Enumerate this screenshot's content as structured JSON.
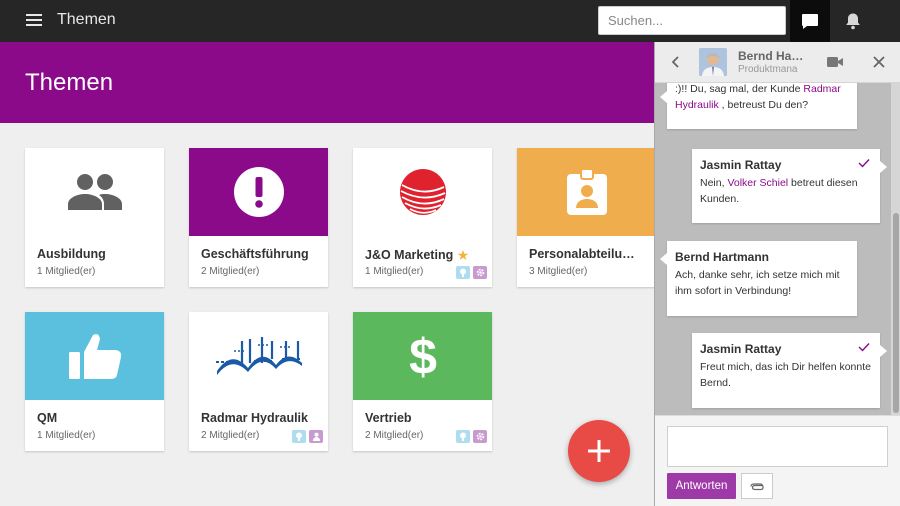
{
  "topbar": {
    "title": "Themen",
    "search_placeholder": "Suchen...",
    "menu_icon": "hamburger-icon",
    "chat_icon": "chat-bubble-icon",
    "notification_icon": "bell-icon"
  },
  "header": {
    "title": "Themen",
    "color": "#8a0a8a"
  },
  "tiles": [
    {
      "name": "Ausbildung",
      "members": "1 Mitglied(er)",
      "icon": "people-icon",
      "color": "#ffffff"
    },
    {
      "name": "Geschäftsführung",
      "members": "2 Mitglied(er)",
      "icon": "exclamation-icon",
      "color": "#8a0a8a"
    },
    {
      "name": "J&O Marketing",
      "members": "1 Mitglied(er)",
      "icon": "marketing-logo",
      "color": "#ffffff",
      "starred": true,
      "badges": [
        "lightbulb-icon",
        "gear-icon"
      ]
    },
    {
      "name": "Personalabteilu…",
      "members": "3 Mitglied(er)",
      "icon": "id-badge-icon",
      "color": "#f0ad4e"
    },
    {
      "name": "QM",
      "members": "1 Mitglied(er)",
      "icon": "thumbs-up-icon",
      "color": "#5bc0de"
    },
    {
      "name": "Radmar Hydraulik",
      "members": "2 Mitglied(er)",
      "icon": "radmar-logo",
      "color": "#ffffff",
      "badges": [
        "lightbulb-icon",
        "person-icon"
      ]
    },
    {
      "name": "Vertrieb",
      "members": "2 Mitglied(er)",
      "icon": "dollar-icon",
      "color": "#5cb85c",
      "badges": [
        "lightbulb-icon",
        "gear-icon"
      ]
    }
  ],
  "fab": {
    "icon": "plus-icon",
    "color": "#e84a45"
  },
  "chat": {
    "contact_name": "Bernd Ha…",
    "contact_role": "Produktmana",
    "messages": [
      {
        "from": "",
        "direction": "received",
        "pre": ":)!! Du, sag mal, der Kunde ",
        "link": "Radmar Hydraulik",
        "post": " , betreust Du den?"
      },
      {
        "from": "Jasmin Rattay",
        "direction": "sent",
        "pre": "Nein, ",
        "link": "Volker Schiel",
        "post": " betreut diesen Kunden."
      },
      {
        "from": "Bernd Hartmann",
        "direction": "received",
        "text": "Ach, danke sehr, ich setze mich mit ihm sofort in Verbindung!"
      },
      {
        "from": "Jasmin Rattay",
        "direction": "sent",
        "text": "Freut mich, das ich Dir helfen konnte Bernd."
      }
    ],
    "reply_label": "Antworten",
    "reply_placeholder": ""
  }
}
